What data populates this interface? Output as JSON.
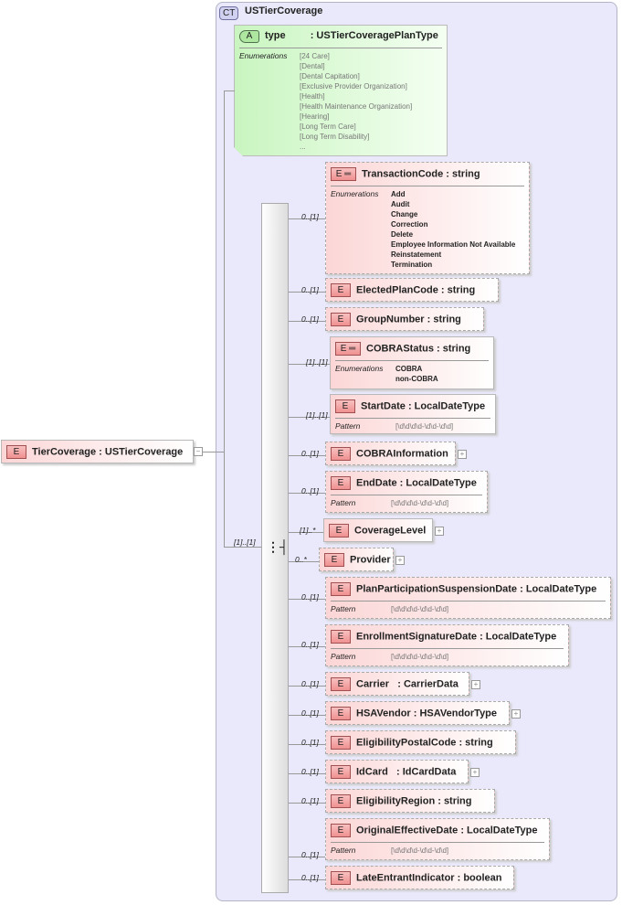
{
  "root": {
    "badge": "E",
    "label": "TierCoverage : USTierCoverage"
  },
  "complex_type": {
    "badge": "CT",
    "title": "USTierCoverage"
  },
  "attribute": {
    "badge": "A",
    "name": "type",
    "type": ": USTierCoveragePlanType",
    "enum_label": "Enumerations",
    "values": [
      "[24 Care]",
      "[Dental]",
      "[Dental Capitation]",
      "[Exclusive Provider Organization]",
      "[Health]",
      "[Health Maintenance Organization]",
      "[Hearing]",
      "[Long Term Care]",
      "[Long Term Disability]",
      "..."
    ]
  },
  "sequence": {
    "multiplicity": "[1]..[1]"
  },
  "elements": [
    {
      "name": "TransactionCode : string",
      "mult": "0..[1]",
      "badge": "E ═",
      "detail_label": "Enumerations",
      "values": [
        "Add",
        "Audit",
        "Change",
        "Correction",
        "Delete",
        "Employee Information Not Available",
        "Reinstatement",
        "Termination"
      ]
    },
    {
      "name": "ElectedPlanCode : string",
      "mult": "0..[1]",
      "badge": "E"
    },
    {
      "name": "GroupNumber : string",
      "mult": "0..[1]",
      "badge": "E"
    },
    {
      "name": "COBRAStatus : string",
      "mult": "[1]..[1]",
      "badge": "E ═",
      "detail_label": "Enumerations",
      "values": [
        "COBRA",
        "non-COBRA"
      ]
    },
    {
      "name": "StartDate : LocalDateType",
      "mult": "[1]..[1]",
      "badge": "E",
      "detail_label": "Pattern",
      "values": [
        "[\\d\\d\\d\\d-\\d\\d-\\d\\d]"
      ]
    },
    {
      "name": "COBRAInformation",
      "mult": "0..[1]",
      "badge": "E",
      "expand": "+"
    },
    {
      "name": "EndDate : LocalDateType",
      "mult": "0..[1]",
      "badge": "E",
      "detail_label": "Pattern",
      "values": [
        "[\\d\\d\\d\\d-\\d\\d-\\d\\d]"
      ]
    },
    {
      "name": "CoverageLevel",
      "mult": "[1]..*",
      "badge": "E",
      "expand": "+"
    },
    {
      "name": "Provider",
      "mult": "0..*",
      "badge": "E",
      "expand": "+"
    },
    {
      "name": "PlanParticipationSuspensionDate : LocalDateType",
      "mult": "0..[1]",
      "badge": "E",
      "detail_label": "Pattern",
      "values": [
        "[\\d\\d\\d\\d-\\d\\d-\\d\\d]"
      ]
    },
    {
      "name": "EnrollmentSignatureDate : LocalDateType",
      "mult": "0..[1]",
      "badge": "E",
      "detail_label": "Pattern",
      "values": [
        "[\\d\\d\\d\\d-\\d\\d-\\d\\d]"
      ]
    },
    {
      "name": "Carrier   : CarrierData",
      "mult": "0..[1]",
      "badge": "E",
      "expand": "+"
    },
    {
      "name": "HSAVendor : HSAVendorType",
      "mult": "0..[1]",
      "badge": "E",
      "expand": "+"
    },
    {
      "name": "EligibilityPostalCode : string",
      "mult": "0..[1]",
      "badge": "E"
    },
    {
      "name": "IdCard   : IdCardData",
      "mult": "0..[1]",
      "badge": "E",
      "expand": "+"
    },
    {
      "name": "EligibilityRegion : string",
      "mult": "0..[1]",
      "badge": "E"
    },
    {
      "name": "OriginalEffectiveDate : LocalDateType",
      "mult": "0..[1]",
      "badge": "E",
      "detail_label": "Pattern",
      "values": [
        "[\\d\\d\\d\\d-\\d\\d-\\d\\d]"
      ]
    },
    {
      "name": "LateEntrantIndicator : boolean",
      "mult": "0..[1]",
      "badge": "E"
    }
  ]
}
